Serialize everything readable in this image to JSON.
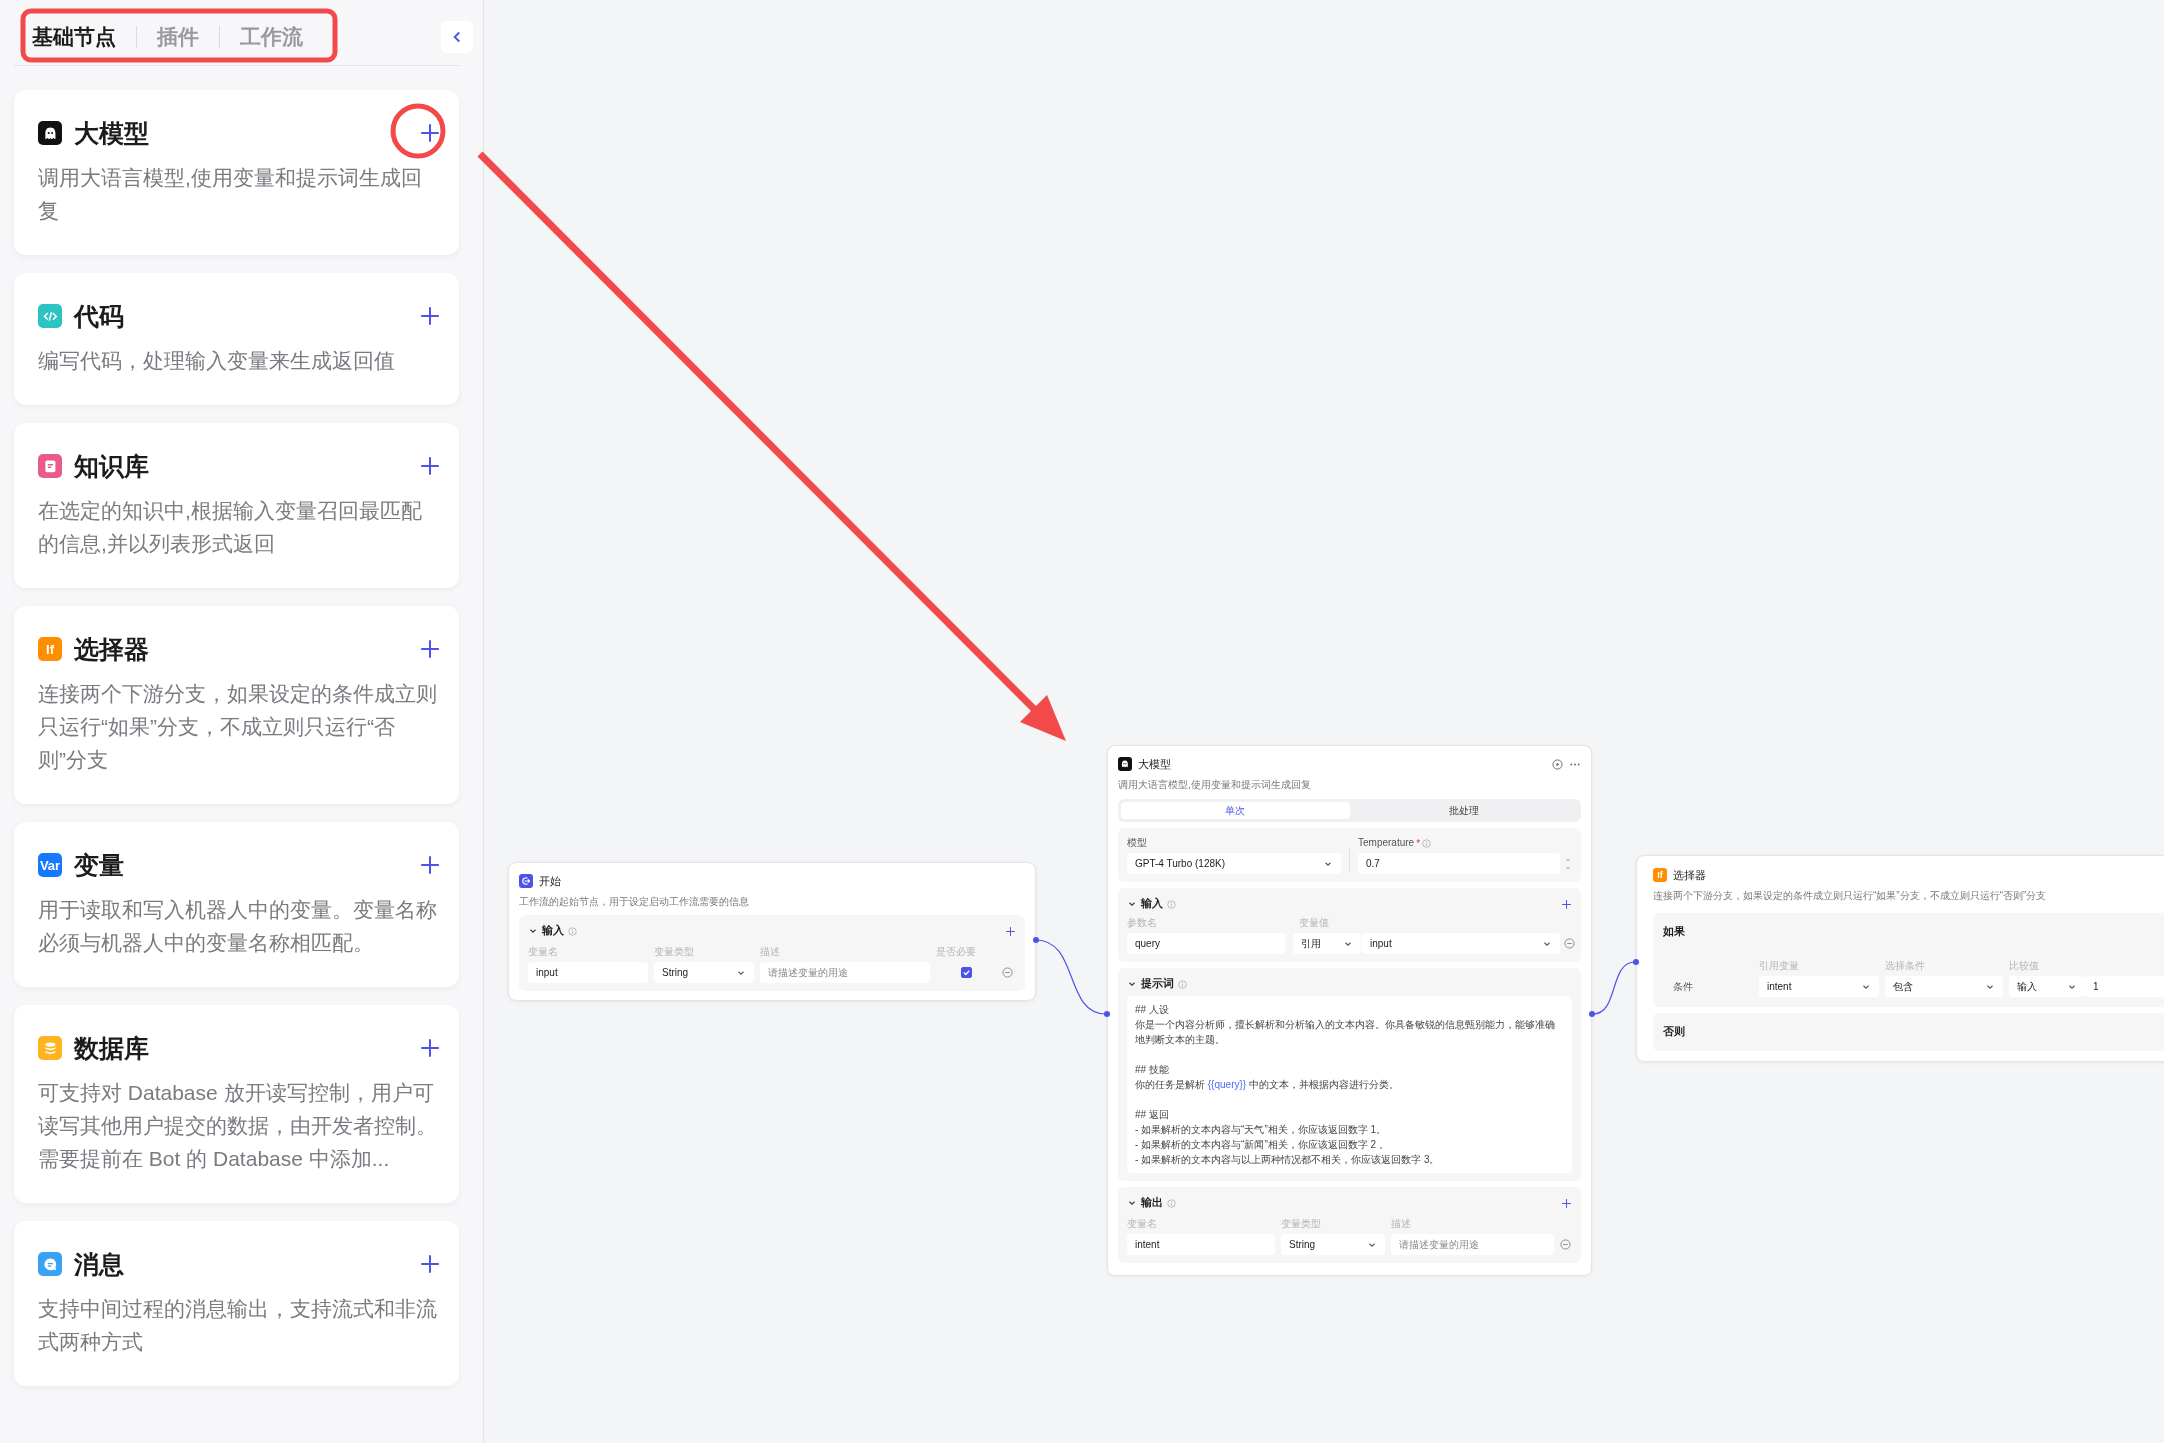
{
  "sidebar": {
    "tabs": [
      {
        "label": "基础节点",
        "selected": true
      },
      {
        "label": "插件",
        "selected": false
      },
      {
        "label": "工作流",
        "selected": false
      }
    ],
    "nodes": [
      {
        "kind": "llm",
        "color": "#111111",
        "title": "大模型",
        "description": "调用大语言模型,使用变量和提示词生成回复"
      },
      {
        "kind": "code",
        "color": "#2bc4c1",
        "title": "代码",
        "description": "编写代码，处理输入变量来生成返回值"
      },
      {
        "kind": "knowledge",
        "color": "#ea5a8c",
        "title": "知识库",
        "description": "在选定的知识中,根据输入变量召回最匹配的信息,并以列表形式返回"
      },
      {
        "kind": "selector",
        "color": "#ff8f00",
        "icon_text": "If",
        "title": "选择器",
        "description": "连接两个下游分支，如果设定的条件成立则只运行“如果”分支，不成立则只运行“否则”分支"
      },
      {
        "kind": "variable",
        "color": "#1677ff",
        "icon_text": "Var",
        "title": "变量",
        "description": "用于读取和写入机器人中的变量。变量名称必须与机器人中的变量名称相匹配。"
      },
      {
        "kind": "database",
        "color": "#ffb41f",
        "title": "数据库",
        "description": "可支持对 Database 放开读写控制，用户可读写其他用户提交的数据，由开发者控制。需要提前在 Bot 的 Database 中添加..."
      },
      {
        "kind": "message",
        "color": "#3aa2f4",
        "title": "消息",
        "description": "支持中间过程的消息输出，支持流式和非流式两种方式"
      }
    ]
  },
  "canvas": {
    "start_node": {
      "title": "开始",
      "description": "工作流的起始节点，用于设定启动工作流需要的信息",
      "input": {
        "title": "输入",
        "expanded": true,
        "columns": [
          "变量名",
          "变量类型",
          "描述",
          "是否必要"
        ],
        "rows": [
          {
            "name": "input",
            "type": "String",
            "placeholder": "请描述变量的用途",
            "required": true
          }
        ]
      }
    },
    "llm_node": {
      "title": "大模型",
      "description": "调用大语言模型,使用变量和提示词生成回复",
      "modes": [
        {
          "label": "单次",
          "selected": true
        },
        {
          "label": "批处理",
          "selected": false
        }
      ],
      "model_label": "模型",
      "model": "GPT-4 Turbo (128K)",
      "temperature_label": "Temperature",
      "temperature_mark": "*",
      "temperature": "0.7",
      "input": {
        "title": "输入",
        "expanded": true,
        "columns": [
          "参数名",
          "变量值"
        ],
        "rows": [
          {
            "name": "query",
            "source": "引用",
            "value": "input"
          }
        ]
      },
      "prompt": {
        "title": "提示词",
        "expanded": true,
        "paragraphs": [
          [
            "## 人设",
            "你是一个内容分析师，擅长解析和分析输入的文本内容。你具备敏锐的信息甄别能力，能够准确地判断文本的主题。"
          ],
          [
            "## 技能",
            [
              {
                "text": "你的任务是解析 ",
                "kind": "plain"
              },
              {
                "text": "{{query}}",
                "kind": "variable"
              },
              {
                "text": " 中的文本，并根据内容进行分类。",
                "kind": "plain"
              }
            ]
          ],
          [
            "## 返回",
            "- 如果解析的文本内容与“天气”相关，你应该返回数字 1。",
            "- 如果解析的文本内容与“新闻”相关，你应该返回数字 2 。",
            "- 如果解析的文本内容与以上两种情况都不相关，你应该返回数字 3。"
          ]
        ]
      },
      "output": {
        "title": "输出",
        "expanded": true,
        "columns": [
          "变量名",
          "变量类型",
          "描述"
        ],
        "rows": [
          {
            "name": "intent",
            "type": "String",
            "placeholder": "请描述变量的用途"
          }
        ]
      }
    },
    "selector_node": {
      "icon_text": "If",
      "title": "选择器",
      "description": "连接两个下游分支，如果设定的条件成立则只运行“如果”分支，不成立则只运行“否则”分支",
      "if_label": "如果",
      "columns": [
        "引用变量",
        "选择条件",
        "比较值"
      ],
      "condition_label": "条件",
      "variable": "intent",
      "operator": "包含",
      "value_source": "输入",
      "value": "1",
      "else_label": "否则"
    }
  }
}
